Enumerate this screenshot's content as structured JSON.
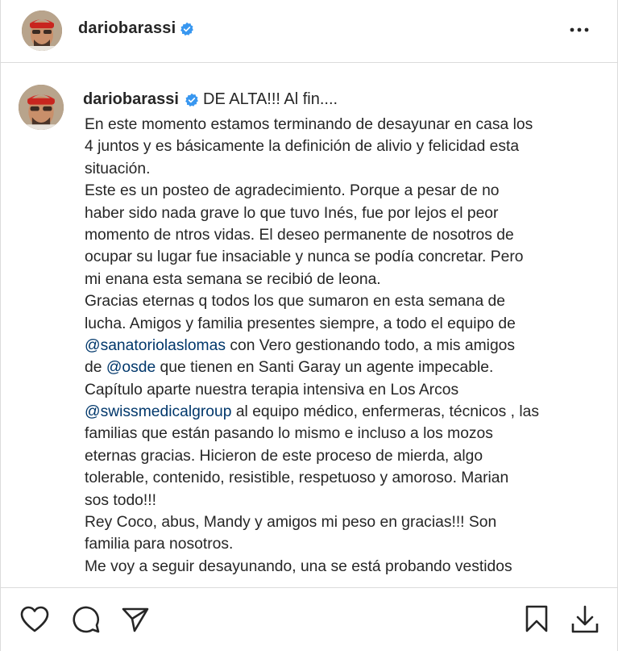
{
  "header": {
    "username": "dariobarassi",
    "more_label": "•••"
  },
  "caption": {
    "username": "dariobarassi",
    "first_line": "DE ALTA!!! Al fin....",
    "lines": [
      [
        {
          "t": "En este momento estamos terminando de desayunar en casa los"
        }
      ],
      [
        {
          "t": "4 juntos y es básicamente la definición de alivio y felicidad esta"
        }
      ],
      [
        {
          "t": "situación."
        }
      ],
      [
        {
          "t": "Este es un posteo de agradecimiento. Porque a pesar de no"
        }
      ],
      [
        {
          "t": "haber sido nada grave lo que tuvo Inés, fue por lejos el peor"
        }
      ],
      [
        {
          "t": "momento de ntros vidas. El deseo permanente de nosotros de"
        }
      ],
      [
        {
          "t": "ocupar su lugar fue insaciable y nunca se podía concretar. Pero"
        }
      ],
      [
        {
          "t": "mi enana esta semana se recibió de leona."
        }
      ],
      [
        {
          "t": "Gracias eternas q todos los que sumaron en esta semana de"
        }
      ],
      [
        {
          "t": "lucha. Amigos y familia presentes siempre, a todo el equipo de"
        }
      ],
      [
        {
          "t": "@sanatoriolaslomas",
          "m": true
        },
        {
          "t": " con Vero gestionando todo, a mis amigos"
        }
      ],
      [
        {
          "t": "de "
        },
        {
          "t": "@osde",
          "m": true
        },
        {
          "t": " que tienen en Santi Garay un agente impecable."
        }
      ],
      [
        {
          "t": "Capítulo aparte nuestra terapia intensiva en Los Arcos"
        }
      ],
      [
        {
          "t": "@swissmedicalgroup",
          "m": true
        },
        {
          "t": " al equipo médico, enfermeras, técnicos , las"
        }
      ],
      [
        {
          "t": "familias que están pasando lo mismo e incluso a los mozos"
        }
      ],
      [
        {
          "t": "eternas gracias. Hicieron de este proceso de mierda, algo"
        }
      ],
      [
        {
          "t": "tolerable, contenido, resistible, respetuoso y amoroso. Marian"
        }
      ],
      [
        {
          "t": "sos todo!!!"
        }
      ],
      [
        {
          "t": "Rey Coco, abus, Mandy y amigos mi peso en gracias!!! Son"
        }
      ],
      [
        {
          "t": "familia para nosotros."
        }
      ],
      [
        {
          "t": "Me voy a seguir desayunando, una se está probando vestidos"
        }
      ]
    ]
  },
  "colors": {
    "text": "#262626",
    "mention": "#00376b",
    "verified": "#3897f0",
    "border": "#dbdbdb"
  },
  "icons": {
    "like": "heart-icon",
    "comment": "comment-icon",
    "share": "send-icon",
    "save": "bookmark-icon",
    "download": "download-icon",
    "more": "more-icon",
    "verified": "verified-badge-icon"
  }
}
